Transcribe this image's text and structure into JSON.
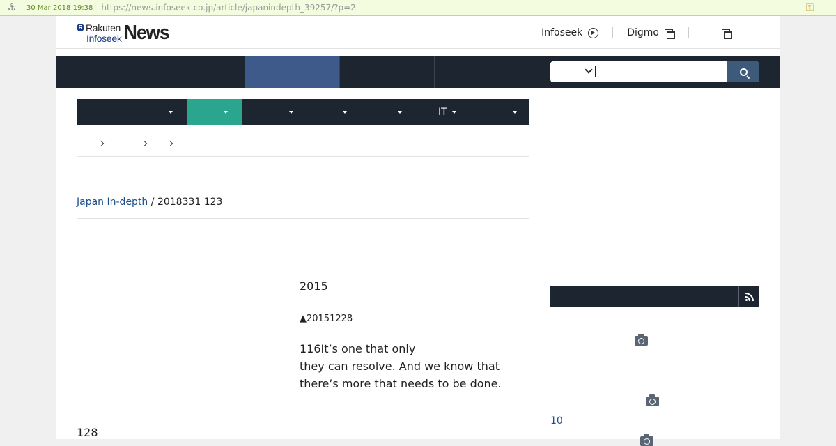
{
  "archive": {
    "date": "30 Mar 2018 19:38",
    "url": "https://news.infoseek.co.jp/article/japanindepth_39257/?p=2"
  },
  "header": {
    "logo": {
      "rakuten": "Rakuten",
      "infoseek": "Infoseek",
      "news": "News"
    },
    "links": [
      {
        "label": "Infoseek",
        "icon": "circle-arrow-icon"
      },
      {
        "label": "Digmo",
        "icon": "external-window-icon"
      },
      {
        "label": "",
        "icon": "external-window-icon"
      }
    ]
  },
  "global_nav": {
    "items": [
      "",
      "",
      "",
      "",
      ""
    ],
    "active_index": 2
  },
  "search": {
    "category_value": "",
    "query": ""
  },
  "category_nav": {
    "items": [
      {
        "label": ""
      },
      {
        "label": ""
      },
      {
        "label": ""
      },
      {
        "label": ""
      },
      {
        "label": ""
      },
      {
        "label": "IT"
      },
      {
        "label": ""
      }
    ],
    "active_index": 1
  },
  "article": {
    "source": "Japan In-depth",
    "separator": "/",
    "date": "2018331 123",
    "year_heading": "2015",
    "date_caption": "▲20151228",
    "quote_line1": "116It’s one that only",
    "quote_line2": "they can resolve. And we know that",
    "quote_line3": "there’s more that needs to be done.",
    "next_paragraph": "128"
  },
  "sidebar": {
    "rss_icon": "rss-icon",
    "photo_icon": "camera-icon",
    "count": "10"
  },
  "colors": {
    "nav_dark": "#1d2530",
    "nav_active": "#3e5a8a",
    "category_active": "#2aa68e",
    "link_blue": "#1e4e8c",
    "archive_bar": "#f4fce0"
  }
}
